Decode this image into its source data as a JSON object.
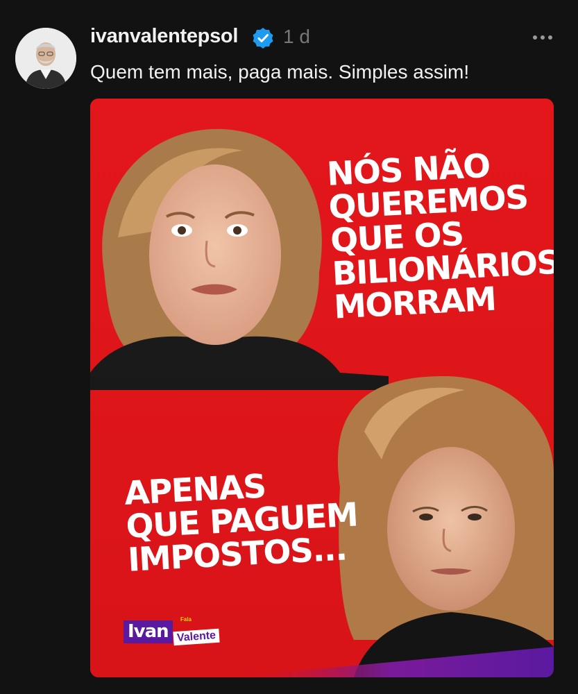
{
  "post": {
    "username": "ivanvalentepsol",
    "timestamp": "1 d",
    "caption": "Quem tem mais, paga mais. Simples assim!",
    "icons": {
      "verified": "verified-badge-icon",
      "more": "more-options-icon"
    }
  },
  "image": {
    "headline_top": [
      "NÓS NÃO",
      "QUEREMOS",
      "QUE OS",
      "BILIONÁRIOS",
      "MORRAM"
    ],
    "headline_bottom": [
      "APENAS",
      "QUE PAGUEM",
      "IMPOSTOS..."
    ],
    "logo": {
      "main": "Ivan",
      "small": "Fala",
      "sub": "Valente"
    }
  },
  "colors": {
    "background": "#121212",
    "card_red": "#e0161a",
    "verified_blue": "#1d9bf0",
    "logo_purple": "#5a1aa0",
    "text_primary": "#f2f2f2",
    "text_muted": "#777777"
  }
}
